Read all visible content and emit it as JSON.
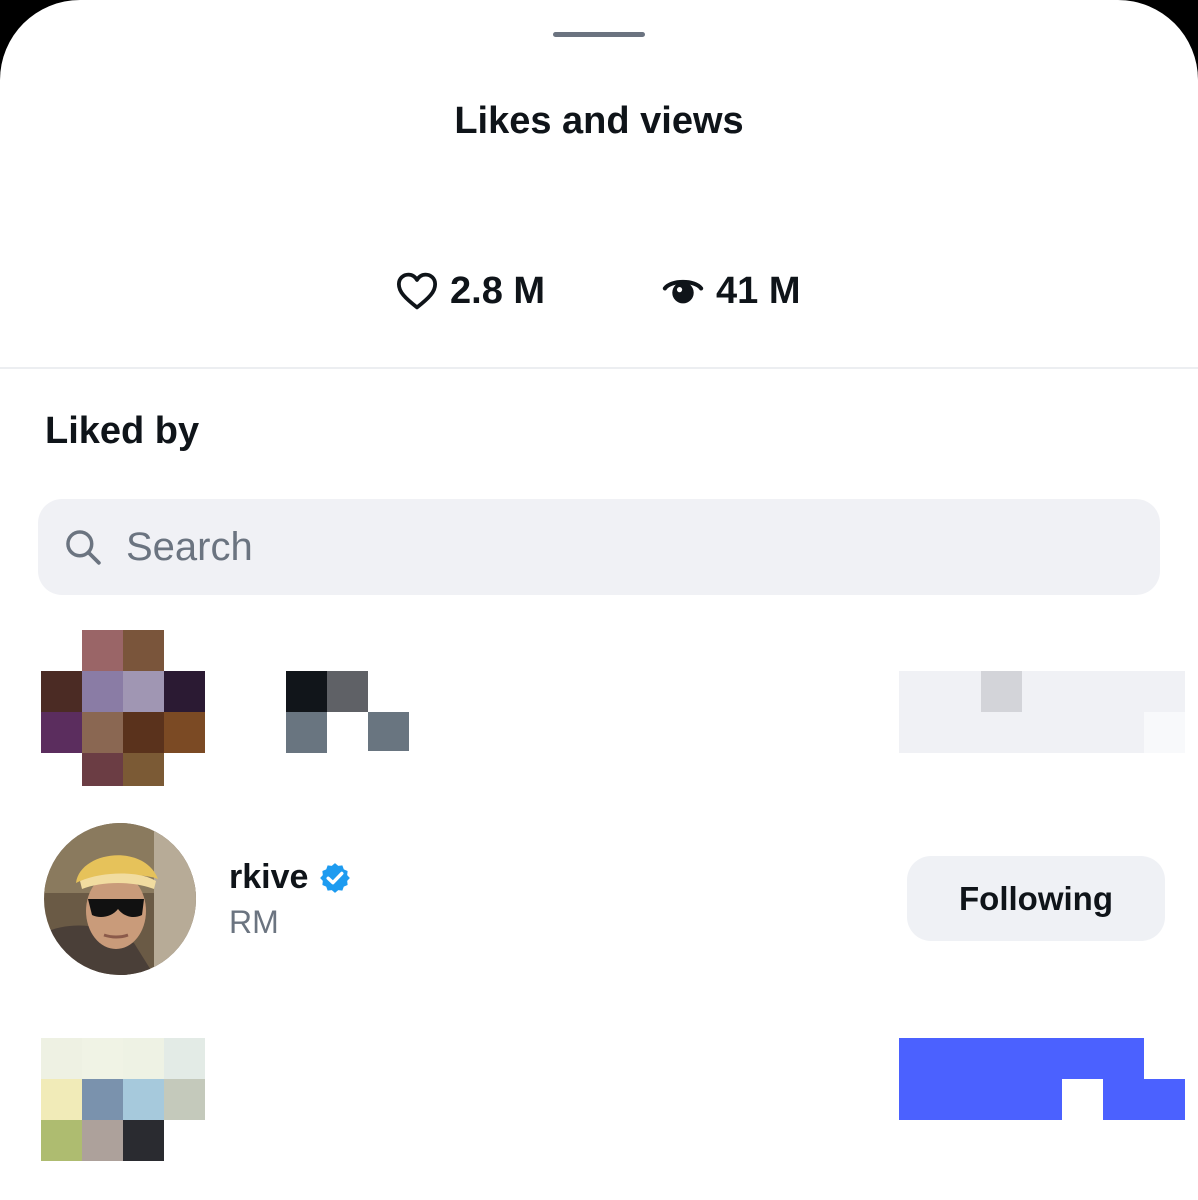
{
  "sheet": {
    "title": "Likes and views"
  },
  "stats": {
    "likes": {
      "icon": "heart-outline-icon",
      "value": "2.8 M"
    },
    "views": {
      "icon": "eye-icon",
      "value": "41 M"
    }
  },
  "liked_by": {
    "title": "Liked by",
    "search": {
      "placeholder": "Search",
      "value": "",
      "icon": "search-icon"
    },
    "users": [
      {
        "name": "rkive",
        "verified": true,
        "display_name": "RM",
        "button_label": "Following"
      }
    ]
  },
  "colors": {
    "text": "#0f1419",
    "secondary_text": "#6b7480",
    "search_bg": "#f0f1f5",
    "button_bg": "#eff1f5",
    "verified": "#1d9bf0",
    "follow_accent": "#4b61ff"
  }
}
